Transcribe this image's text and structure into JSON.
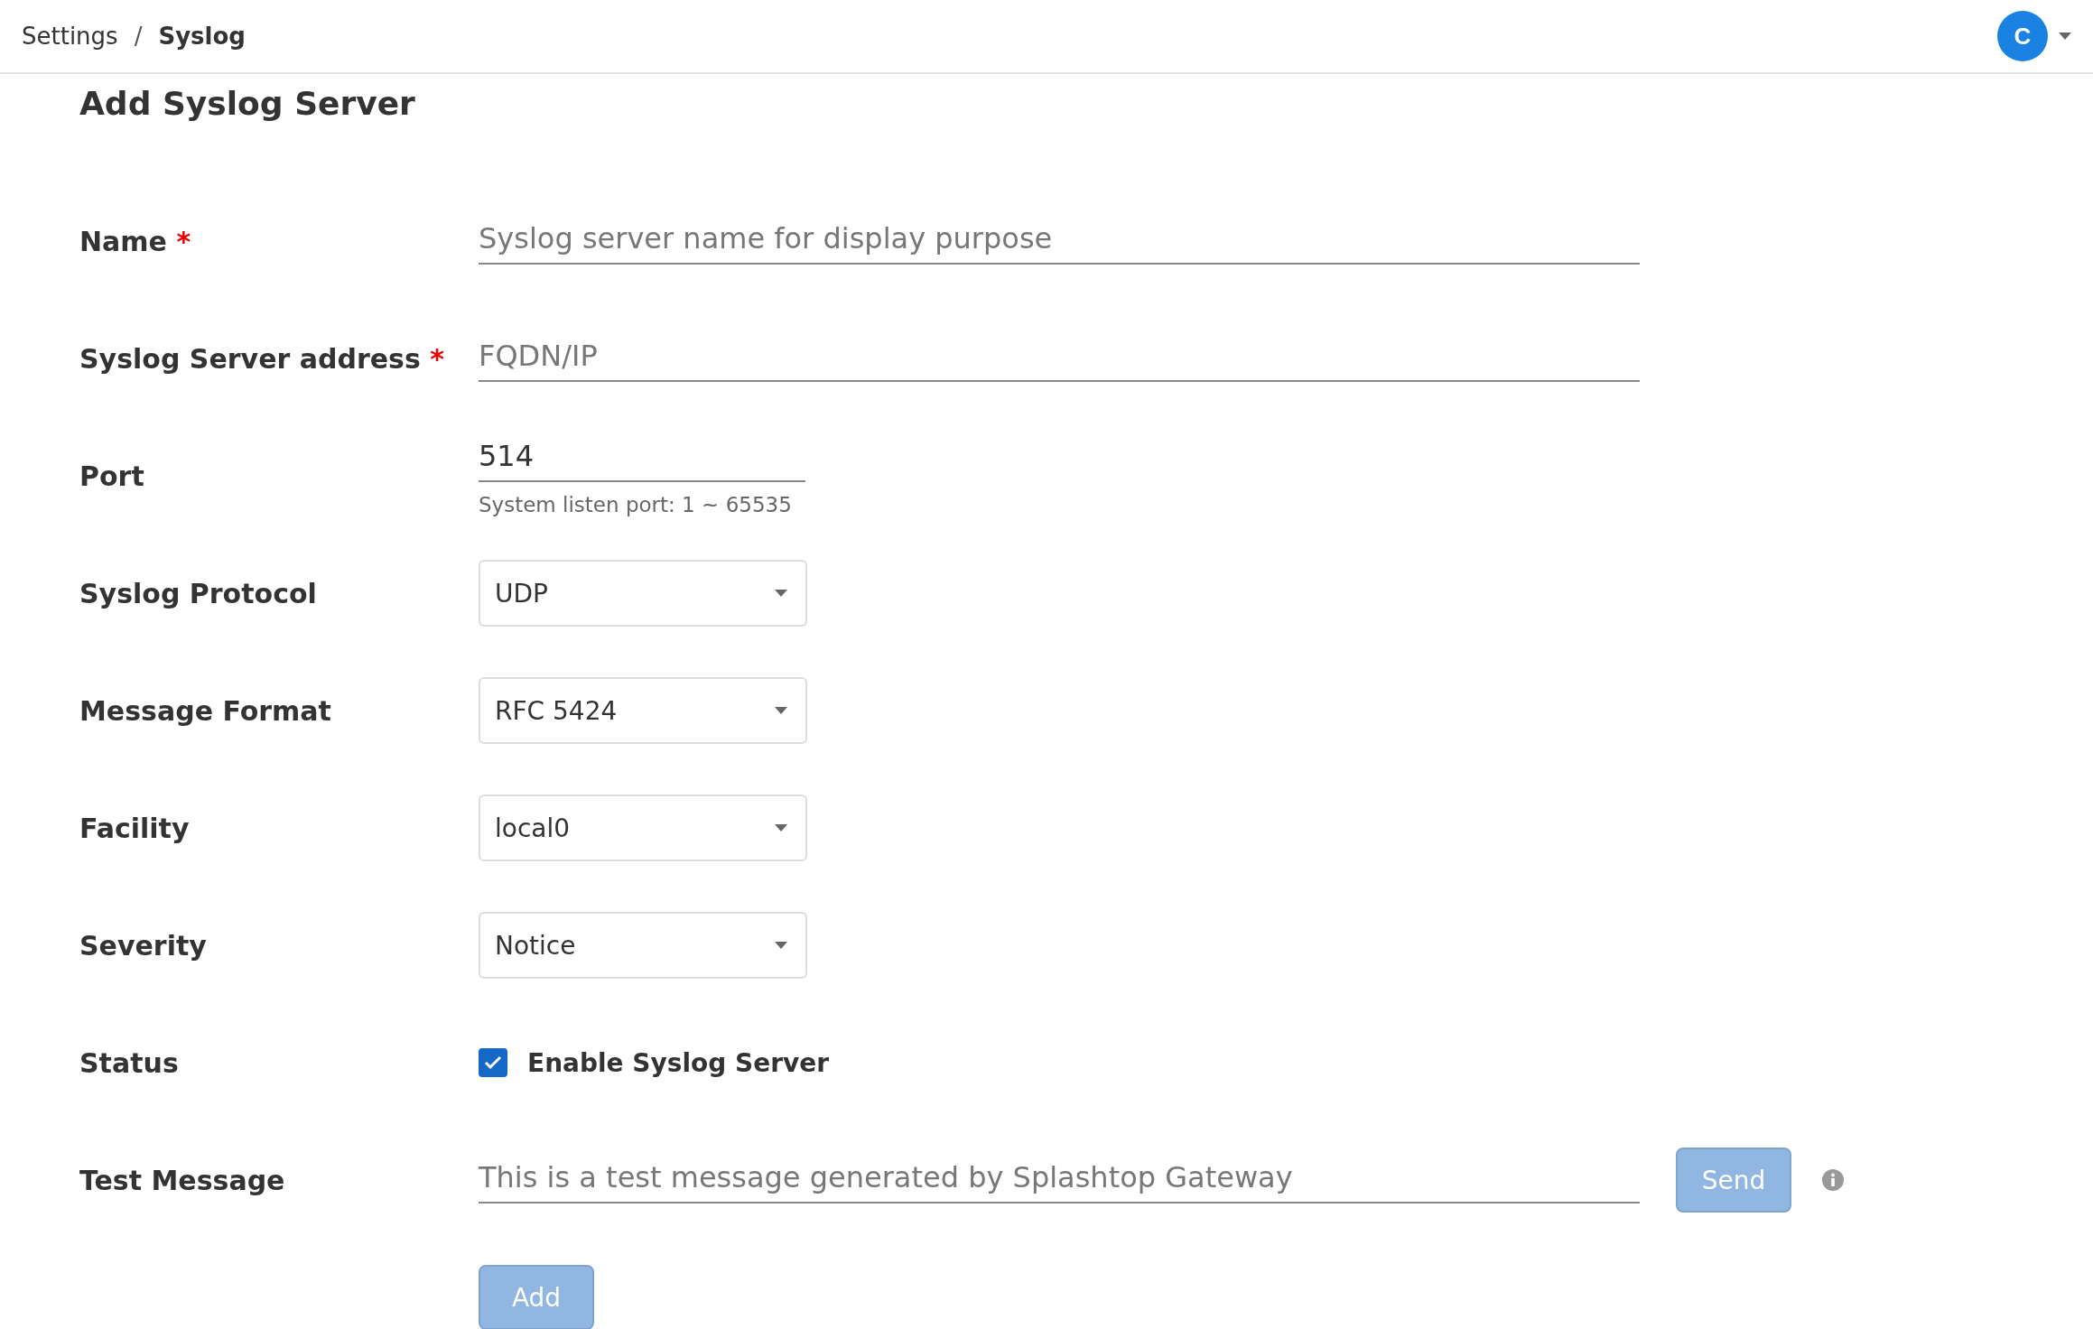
{
  "breadcrumb": [
    {
      "label": "Settings",
      "current": false
    },
    {
      "label": "Syslog",
      "current": true
    }
  ],
  "breadcrumb_separator": "/",
  "required_mark": "*",
  "user": {
    "initial": "C"
  },
  "title": "Add Syslog Server",
  "rows": [
    {
      "kind": "text",
      "label": "Name",
      "required": true,
      "placeholder": "Syslog server name for display purpose"
    },
    {
      "kind": "text",
      "label": "Syslog Server address",
      "required": true,
      "placeholder": "FQDN/IP"
    },
    {
      "kind": "short_text",
      "label": "Port",
      "value": "514",
      "hint": "System listen port: 1 ~ 65535"
    },
    {
      "kind": "select",
      "label": "Syslog Protocol",
      "value": "UDP"
    },
    {
      "kind": "select",
      "label": "Message Format",
      "value": "RFC 5424"
    },
    {
      "kind": "select",
      "label": "Facility",
      "value": "local0"
    },
    {
      "kind": "select",
      "label": "Severity",
      "value": "Notice"
    },
    {
      "kind": "checkbox",
      "label": "Status",
      "text": "Enable Syslog Server",
      "checked": true
    },
    {
      "kind": "text_with_button",
      "label": "Test Message",
      "placeholder": "This is a test message generated by Splashtop Gateway",
      "button": {
        "label": "Send",
        "disabled": true
      }
    }
  ],
  "submit": {
    "label": "Add",
    "disabled": true
  }
}
